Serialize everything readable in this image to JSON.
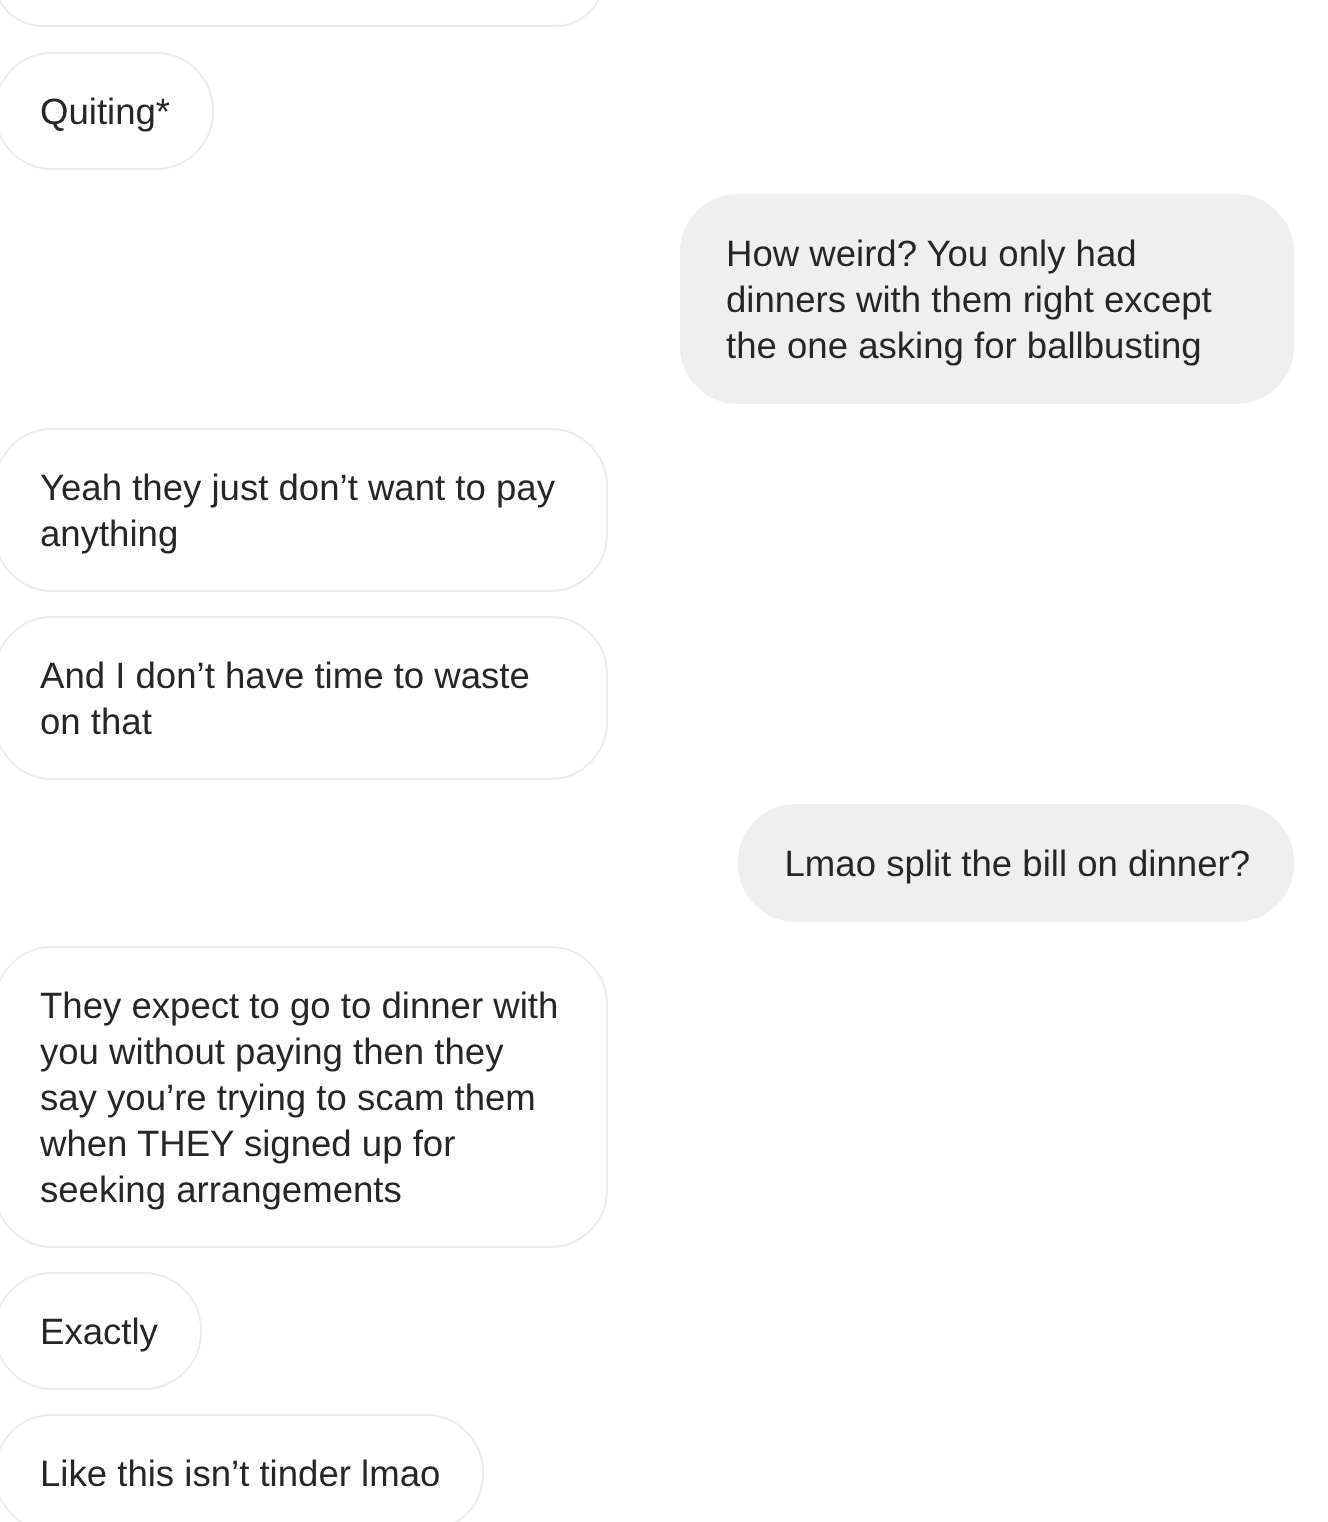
{
  "messages": [
    {
      "kind": "incoming",
      "cut_off": true
    },
    {
      "kind": "incoming",
      "text": "Quiting*"
    },
    {
      "kind": "outgoing",
      "text": "How weird? You only had dinners with them right except the one asking for ballbusting"
    },
    {
      "kind": "incoming",
      "text": "Yeah they just don’t want to pay anything"
    },
    {
      "kind": "incoming",
      "text": "And I don’t have time to waste on that"
    },
    {
      "kind": "outgoing",
      "text": "Lmao split the bill on dinner?"
    },
    {
      "kind": "incoming",
      "text": "They expect to go to dinner with you without paying then they say you’re trying to scam them when THEY signed up for seeking arrangements"
    },
    {
      "kind": "incoming",
      "text": "Exactly"
    },
    {
      "kind": "incoming",
      "text": "Like this isn’t tinder lmao"
    }
  ]
}
